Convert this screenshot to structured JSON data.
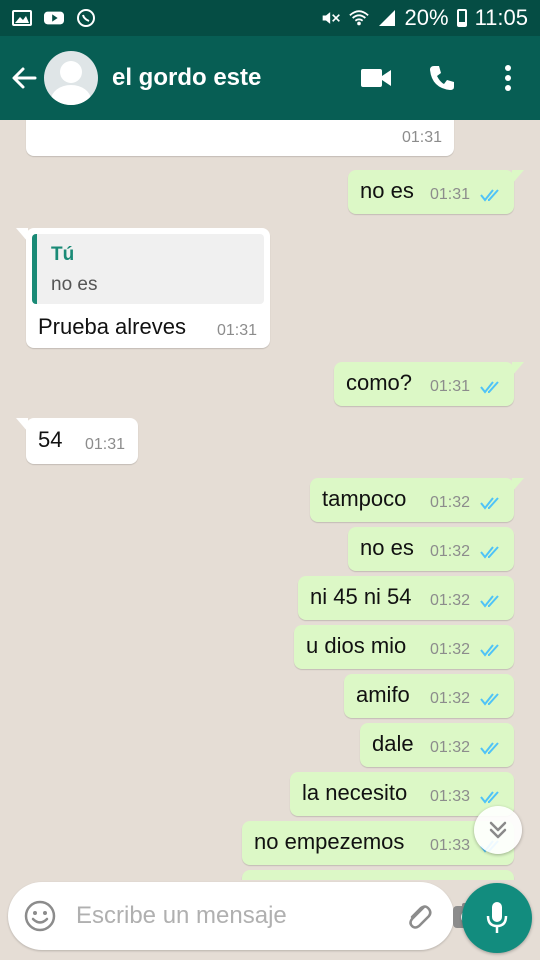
{
  "status_bar": {
    "battery_percent": "20%",
    "time": "11:05",
    "icons": [
      "gallery-icon",
      "youtube-icon",
      "whatsapp-icon",
      "mute-icon",
      "wifi-icon",
      "signal-icon",
      "battery-icon"
    ]
  },
  "header": {
    "contact_name": "el gordo este",
    "icons": [
      "back-arrow-icon",
      "avatar",
      "video-call-icon",
      "phone-call-icon",
      "more-options-icon"
    ]
  },
  "messages": [
    {
      "id": "m0",
      "direction": "incoming",
      "text": "",
      "time": "01:31",
      "partial": true
    },
    {
      "id": "m1",
      "direction": "outgoing",
      "text": "no es",
      "time": "01:31",
      "read": true
    },
    {
      "id": "m2",
      "direction": "incoming",
      "text": "Prueba alreves",
      "time": "01:31",
      "quote": {
        "author": "Tú",
        "text": "no es"
      }
    },
    {
      "id": "m3",
      "direction": "outgoing",
      "text": "como?",
      "time": "01:31",
      "read": true
    },
    {
      "id": "m4",
      "direction": "incoming",
      "text": "54",
      "time": "01:31"
    },
    {
      "id": "m5",
      "direction": "outgoing",
      "text": "tampoco",
      "time": "01:32",
      "read": true
    },
    {
      "id": "m6",
      "direction": "outgoing",
      "text": "no es",
      "time": "01:32",
      "read": true
    },
    {
      "id": "m7",
      "direction": "outgoing",
      "text": "ni 45 ni 54",
      "time": "01:32",
      "read": true
    },
    {
      "id": "m8",
      "direction": "outgoing",
      "text": "u dios mio",
      "time": "01:32",
      "read": true
    },
    {
      "id": "m9",
      "direction": "outgoing",
      "text": "amifo",
      "time": "01:32",
      "read": true
    },
    {
      "id": "m10",
      "direction": "outgoing",
      "text": "dale",
      "time": "01:32",
      "read": true
    },
    {
      "id": "m11",
      "direction": "outgoing",
      "text": "la necesito",
      "time": "01:33",
      "read": true
    },
    {
      "id": "m12",
      "direction": "outgoing",
      "text": "no empezemos",
      "time": "01:33",
      "read": true
    }
  ],
  "input": {
    "placeholder": "Escribe un mensaje",
    "value": ""
  },
  "colors": {
    "status_bar": "#054d44",
    "app_bar": "#075e54",
    "chat_background": "#e5ddd5",
    "outgoing_bubble": "#dcf8c6",
    "incoming_bubble": "#ffffff",
    "read_ticks": "#4fc3f7",
    "accent": "#128c7e"
  }
}
